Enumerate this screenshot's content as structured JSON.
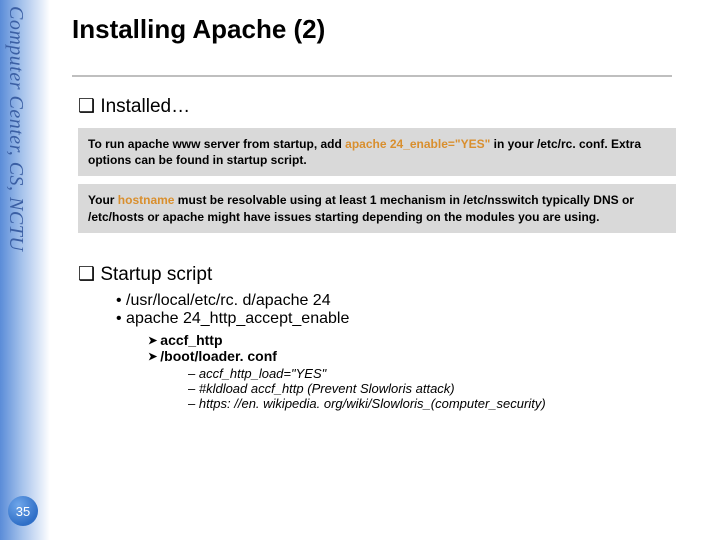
{
  "rail": {
    "label": "Computer Center, CS, NCTU"
  },
  "page": {
    "number": "35"
  },
  "title": "Installing Apache (2)",
  "section_installed": {
    "heading": "Installed…"
  },
  "box1": {
    "pre": "To run apache www server from startup, add ",
    "hl": "apache 24_enable=\"YES\"",
    "post": " in your /etc/rc. conf. Extra options can be found in startup script."
  },
  "box2": {
    "pre": "Your ",
    "hl": "hostname",
    "post": " must be resolvable using at least 1 mechanism in /etc/nsswitch typically DNS or /etc/hosts or apache might have issues starting depending on the modules you are using."
  },
  "section_startup": {
    "heading": "Startup script"
  },
  "bullets": {
    "b1": "/usr/local/etc/rc. d/apache 24",
    "b2": "apache 24_http_accept_enable"
  },
  "arrows": {
    "a1": "accf_http",
    "a2": "/boot/loader. conf"
  },
  "dashes": {
    "d1": "accf_http_load=\"YES\"",
    "d2": "#kldload accf_http (Prevent Slowloris attack)",
    "d3": "https: //en. wikipedia. org/wiki/Slowloris_(computer_security)"
  }
}
